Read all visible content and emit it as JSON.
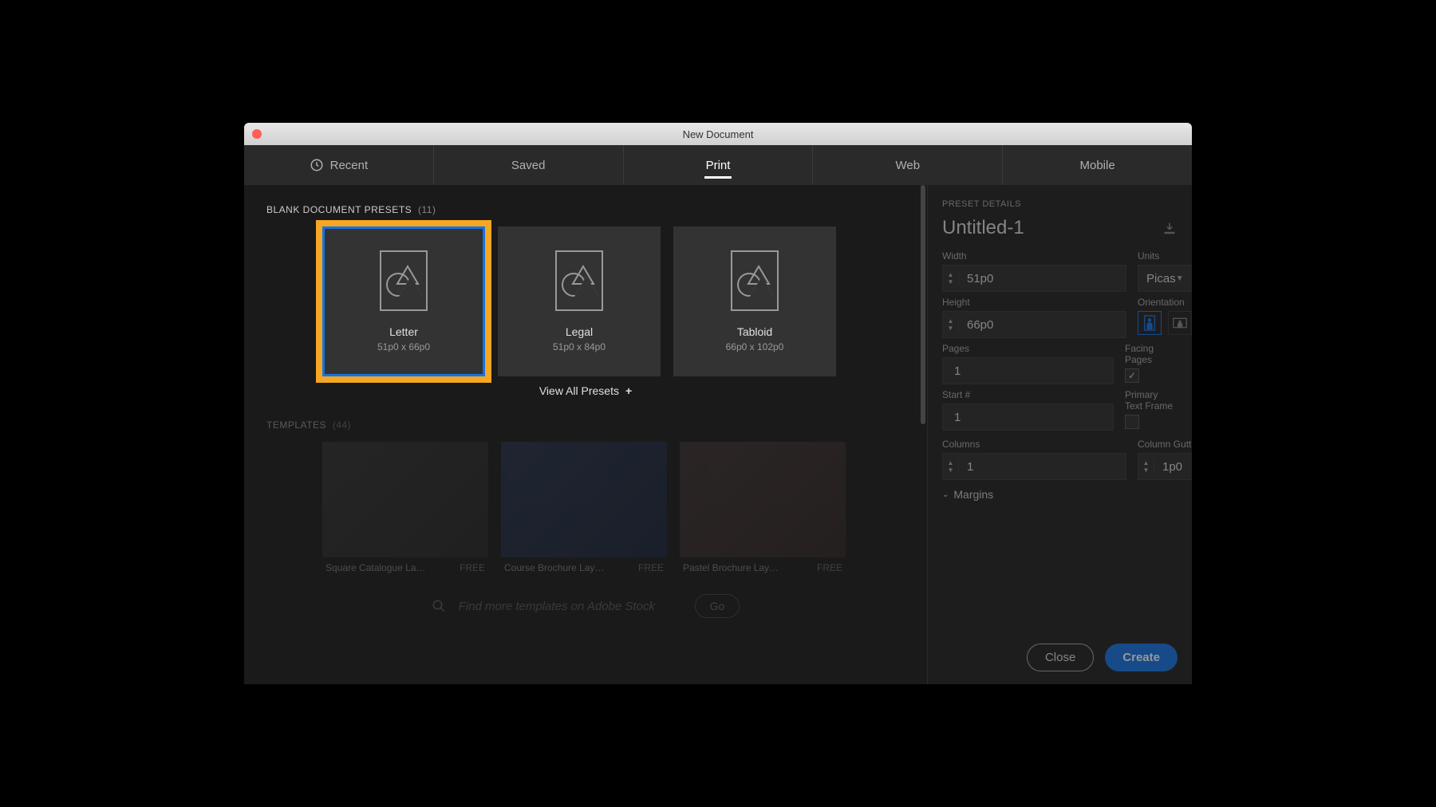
{
  "window": {
    "title": "New Document"
  },
  "tabs": {
    "recent": "Recent",
    "saved": "Saved",
    "print": "Print",
    "web": "Web",
    "mobile": "Mobile"
  },
  "presets_section": {
    "title": "BLANK DOCUMENT PRESETS",
    "count": "(11)"
  },
  "presets": [
    {
      "name": "Letter",
      "dims": "51p0 x 66p0"
    },
    {
      "name": "Legal",
      "dims": "51p0 x 84p0"
    },
    {
      "name": "Tabloid",
      "dims": "66p0 x 102p0"
    }
  ],
  "view_all": "View All Presets",
  "templates_section": {
    "title": "TEMPLATES",
    "count": "(44)"
  },
  "templates": [
    {
      "name": "Square Catalogue La…",
      "price": "FREE"
    },
    {
      "name": "Course Brochure Lay…",
      "price": "FREE"
    },
    {
      "name": "Pastel Brochure Lay…",
      "price": "FREE"
    }
  ],
  "search": {
    "placeholder": "Find more templates on Adobe Stock",
    "go": "Go"
  },
  "details": {
    "heading": "PRESET DETAILS",
    "doc_name": "Untitled-1",
    "width_label": "Width",
    "width_value": "51p0",
    "units_label": "Units",
    "units_value": "Picas",
    "height_label": "Height",
    "height_value": "66p0",
    "orientation_label": "Orientation",
    "pages_label": "Pages",
    "pages_value": "1",
    "facing_label": "Facing Pages",
    "facing_checked": true,
    "start_label": "Start #",
    "start_value": "1",
    "primary_label": "Primary Text Frame",
    "primary_checked": false,
    "columns_label": "Columns",
    "columns_value": "1",
    "gutter_label": "Column Gutter",
    "gutter_value": "1p0",
    "margins_label": "Margins"
  },
  "footer": {
    "close": "Close",
    "create": "Create"
  }
}
